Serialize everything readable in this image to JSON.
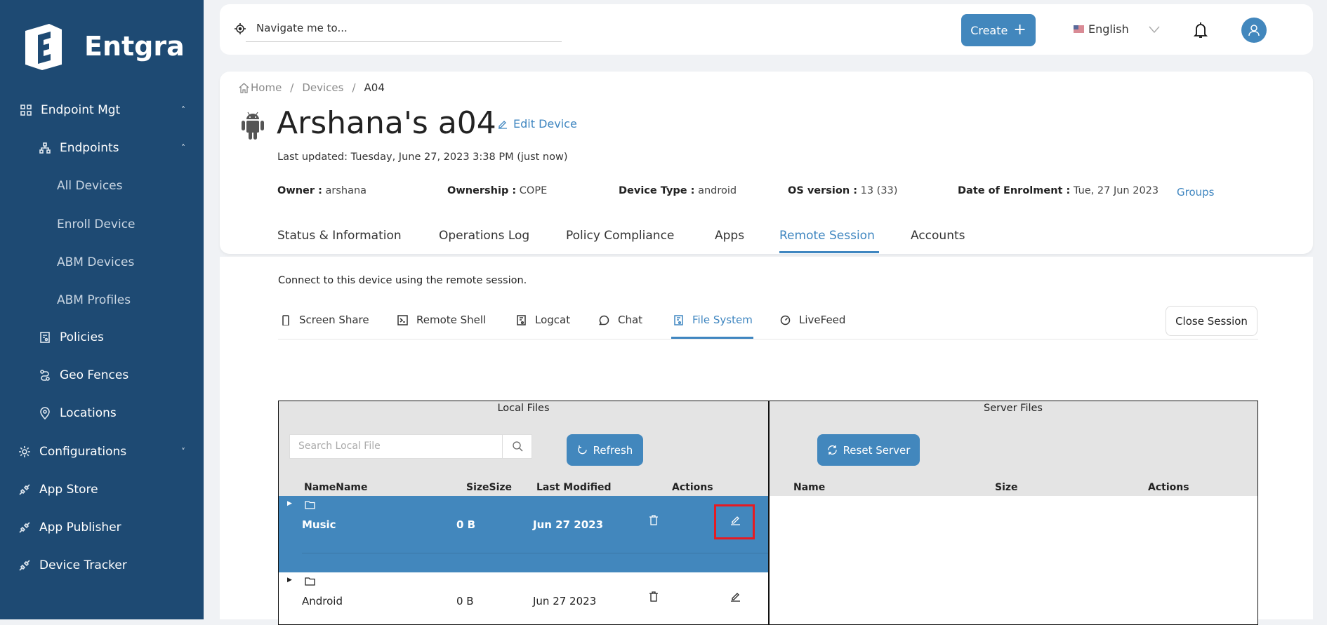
{
  "brand": {
    "name": "Entgra"
  },
  "colors": {
    "sidebar": "#1e4a73",
    "accent": "#4287bd",
    "highlight_border": "#e51b23"
  },
  "sidebar": {
    "items": [
      {
        "label": "Endpoint Mgt",
        "icon": "grid-icon",
        "expanded": true
      },
      {
        "label": "Endpoints",
        "icon": "hierarchy-icon",
        "expanded": true
      },
      {
        "label": "All Devices"
      },
      {
        "label": "Enroll Device"
      },
      {
        "label": "ABM Devices"
      },
      {
        "label": "ABM Profiles"
      },
      {
        "label": "Policies",
        "icon": "policy-icon"
      },
      {
        "label": "Geo Fences",
        "icon": "route-icon"
      },
      {
        "label": "Locations",
        "icon": "location-pin-icon"
      },
      {
        "label": "Configurations",
        "icon": "gear-icon",
        "expanded": false
      },
      {
        "label": "App Store",
        "icon": "plug-icon"
      },
      {
        "label": "App Publisher",
        "icon": "plug-icon"
      },
      {
        "label": "Device Tracker",
        "icon": "plug-icon"
      }
    ]
  },
  "topbar": {
    "navigate_placeholder": "Navigate me to...",
    "create_label": "Create",
    "language": "English"
  },
  "breadcrumb": [
    "Home",
    "Devices",
    "A04"
  ],
  "device": {
    "title": "Arshana's a04",
    "edit_label": "Edit Device",
    "last_updated": "Last updated: Tuesday, June 27, 2023 3:38 PM (just now)",
    "info": [
      {
        "label": "Owner :",
        "value": "arshana"
      },
      {
        "label": "Ownership :",
        "value": "COPE"
      },
      {
        "label": "Device Type :",
        "value": "android"
      },
      {
        "label": "OS version :",
        "value": "13 (33)"
      },
      {
        "label": "Date of Enrolment :",
        "value": "Tue, 27 Jun 2023"
      }
    ],
    "groups_label": "Groups"
  },
  "tabs": [
    "Status & Information",
    "Operations Log",
    "Policy Compliance",
    "Apps",
    "Remote Session",
    "Accounts"
  ],
  "active_tab": "Remote Session",
  "remote": {
    "description": "Connect to this device using the remote session.",
    "subtabs": [
      "Screen Share",
      "Remote Shell",
      "Logcat",
      "Chat",
      "File System",
      "LiveFeed"
    ],
    "active_subtab": "File System",
    "close_label": "Close Session"
  },
  "local_files": {
    "title": "Local Files",
    "search_placeholder": "Search Local File",
    "refresh_label": "Refresh",
    "columns": [
      "NameName",
      "SizeSize",
      "Last Modified",
      "Actions"
    ],
    "rows": [
      {
        "name": "Music",
        "size": "0 B",
        "modified": "Jun 27 2023",
        "selected": true
      },
      {
        "name": "Android",
        "size": "0 B",
        "modified": "Jun 27 2023",
        "selected": false
      }
    ]
  },
  "server_files": {
    "title": "Server Files",
    "reset_label": "Reset Server",
    "columns": [
      "Name",
      "Size",
      "Actions"
    ]
  }
}
